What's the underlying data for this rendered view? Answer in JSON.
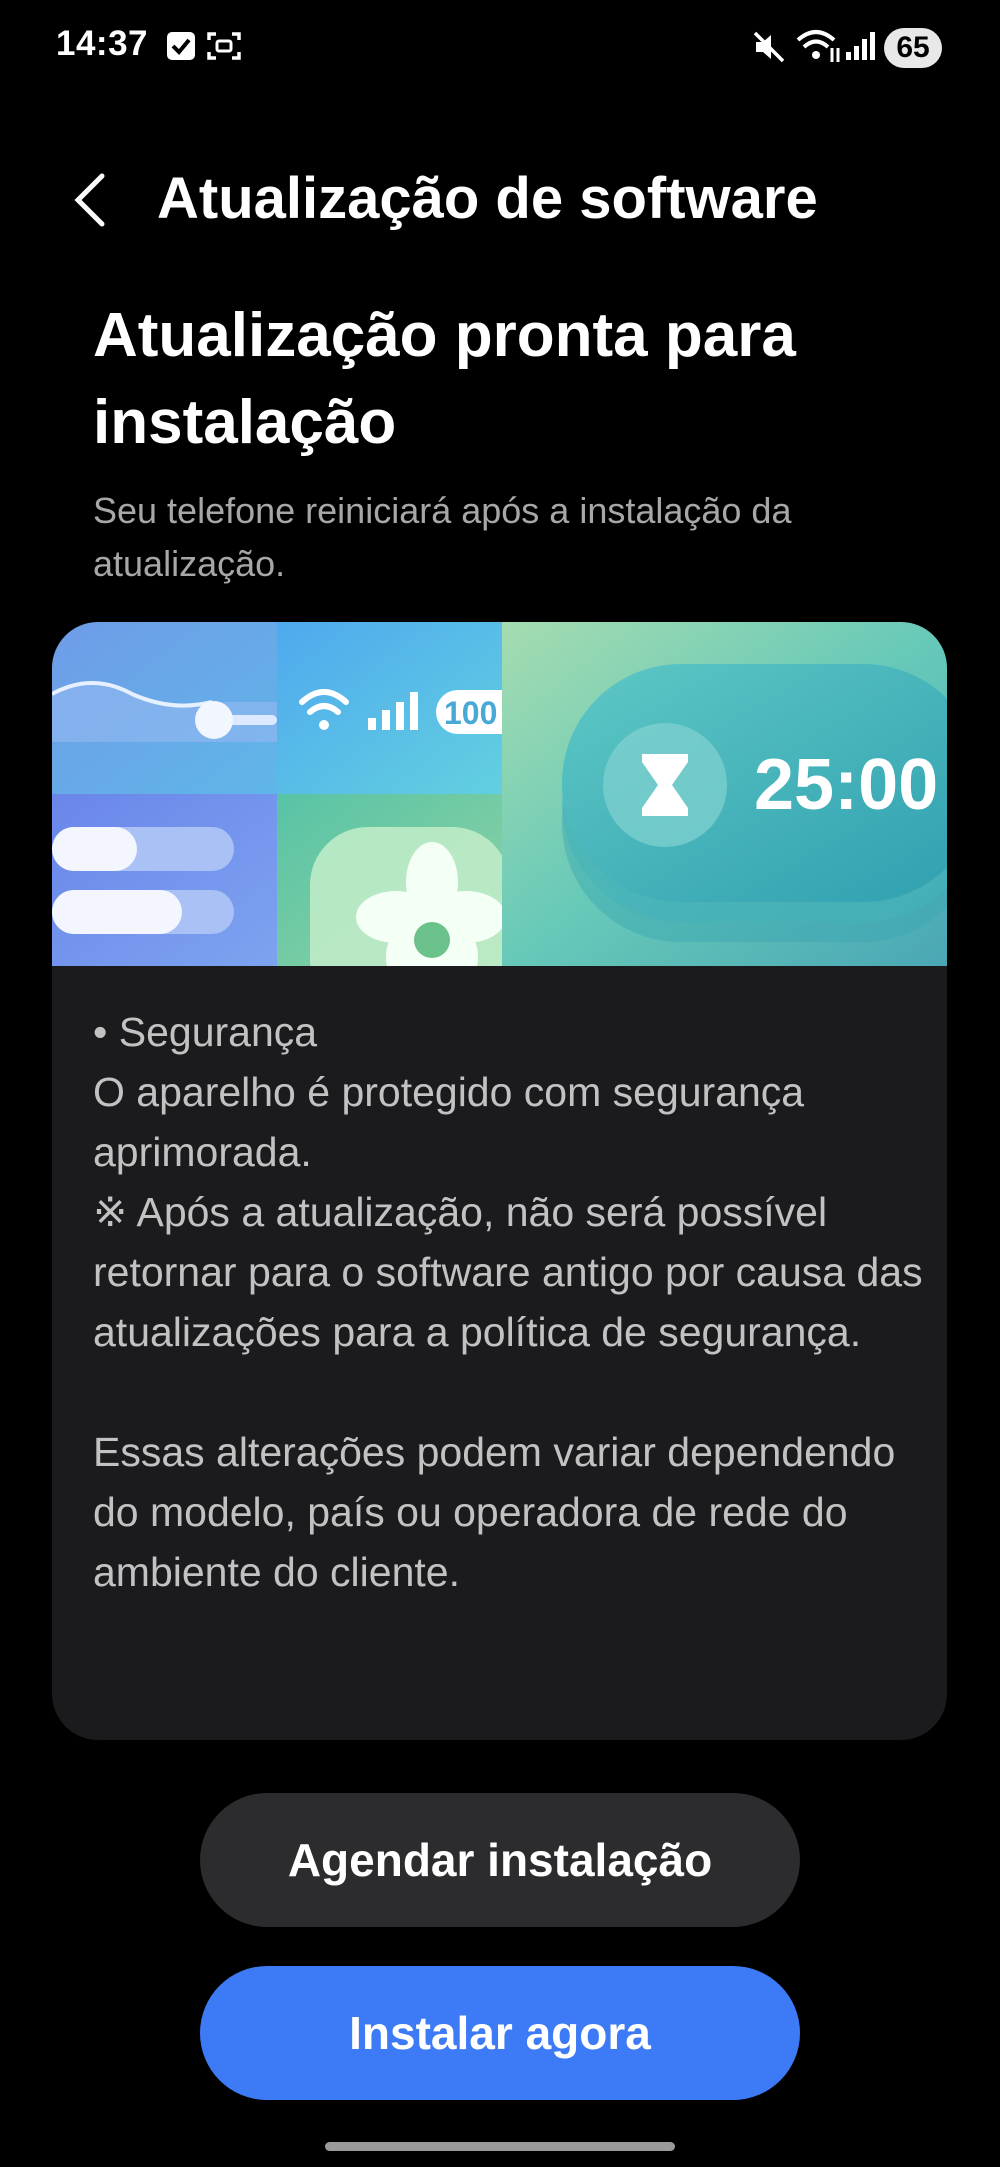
{
  "status_bar": {
    "time": "14:37",
    "battery": "65",
    "icons": [
      "checkbox-notification-icon",
      "screenshot-icon",
      "mute-icon",
      "wifi-icon",
      "signal-icon"
    ]
  },
  "header": {
    "title": "Atualização de software",
    "back_icon": "chevron-left-icon"
  },
  "main": {
    "heading": "Atualização pronta para instalação",
    "subtitle": "Seu telefone reiniciará após a instalação da atualização."
  },
  "banner": {
    "signal_label": "100",
    "timer_value": "25:00",
    "icons": [
      "wifi-icon",
      "signal-icon",
      "hourglass-icon",
      "flower-icon"
    ]
  },
  "release_notes": {
    "text": "• Segurança\nO aparelho é protegido com segurança aprimorada.\n※ Após a atualização, não será possível retornar para o software antigo por causa das atualizações para a política de segurança.\n\nEssas alterações podem variar dependendo do modelo, país ou operadora de rede do ambiente do cliente."
  },
  "actions": {
    "schedule_label": "Agendar instalação",
    "install_label": "Instalar agora"
  },
  "colors": {
    "background": "#000000",
    "card": "#1b1b1e",
    "primary_button": "#3d7bf6",
    "secondary_button": "#2c2c2f"
  }
}
